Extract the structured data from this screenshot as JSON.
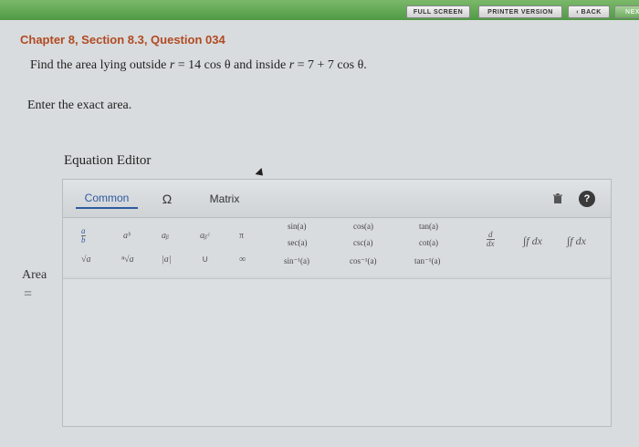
{
  "topbar": {
    "full_screen": "FULL SCREEN",
    "printer_version": "PRINTER VERSION",
    "back": "‹ BACK",
    "next": "NEX"
  },
  "chapter_title": "Chapter 8, Section 8.3, Question 034",
  "question": {
    "prefix": "Find the area lying outside ",
    "var1": "r",
    "eq1": " = 14 cos θ",
    "mid": " and inside ",
    "var2": "r",
    "eq2": " = 7 + 7 cos θ."
  },
  "instruction": "Enter the exact area.",
  "editor": {
    "label": "Equation Editor",
    "tabs": {
      "common": "Common",
      "greek": "Ω",
      "matrix": "Matrix"
    },
    "icons": {
      "trash": "trash-icon",
      "help": "help-icon"
    },
    "symbols": {
      "frac_num": "a",
      "frac_den": "b",
      "power": "aᵇ",
      "subscript": "aᵦ",
      "subsup": "aᵦᶜ",
      "pi": "π",
      "sqrt": "√a",
      "nthroot": "ⁿ√a",
      "abs": "|a|",
      "union": "∪",
      "infinity": "∞",
      "sin": "sin(a)",
      "cos": "cos(a)",
      "tan": "tan(a)",
      "sec": "sec(a)",
      "csc": "csc(a)",
      "cot": "cot(a)",
      "asin": "sin⁻¹(a)",
      "acos": "cos⁻¹(a)",
      "atan": "tan⁻¹(a)",
      "deriv_num": "d",
      "deriv_den": "dx",
      "integral": "∫f dx",
      "def_integral": "∫f dx"
    }
  },
  "answer": {
    "label": "Area",
    "equals": "="
  }
}
